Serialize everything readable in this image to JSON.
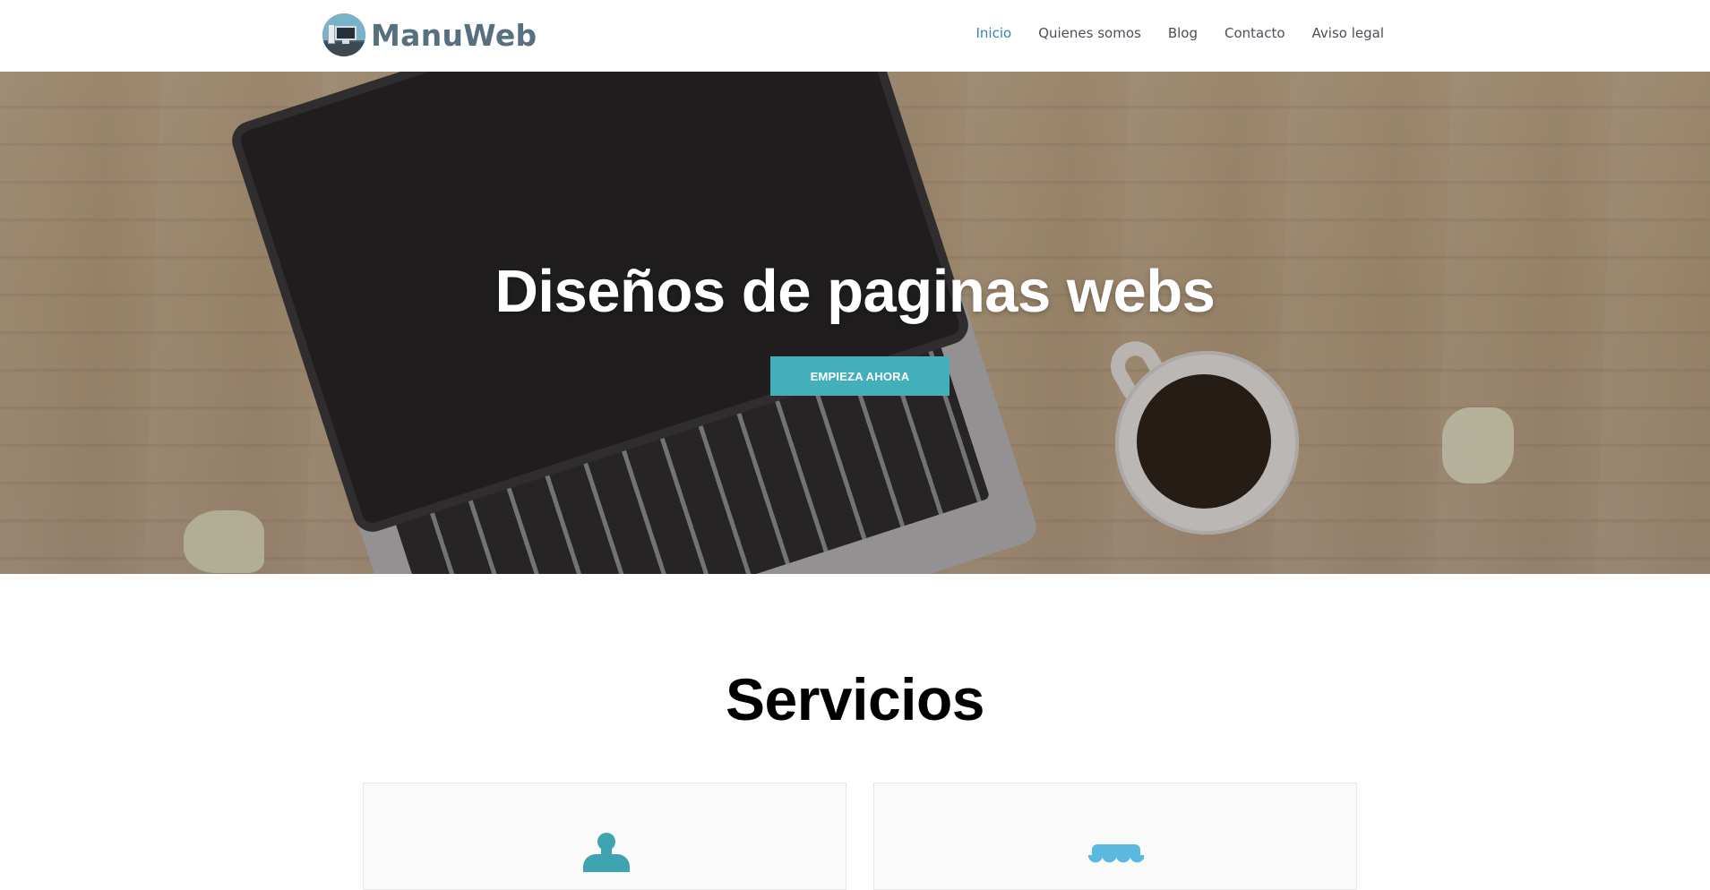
{
  "header": {
    "brand": "ManuWeb",
    "nav": [
      {
        "label": "Inicio",
        "active": true
      },
      {
        "label": "Quienes somos",
        "active": false
      },
      {
        "label": "Blog",
        "active": false
      },
      {
        "label": "Contacto",
        "active": false
      },
      {
        "label": "Aviso legal",
        "active": false
      }
    ]
  },
  "hero": {
    "title": "Diseños de paginas webs",
    "cta_label": "EMPIEZA AHORA"
  },
  "services": {
    "title": "Servicios",
    "cards": [
      {
        "icon": "stamp-icon"
      },
      {
        "icon": "store-awning-icon"
      }
    ]
  },
  "colors": {
    "accent": "#43afba",
    "nav_active": "#2f86a8",
    "nav_text": "#4b4f58",
    "brand_text": "#56707f",
    "awning_icon": "#5bb8df"
  }
}
